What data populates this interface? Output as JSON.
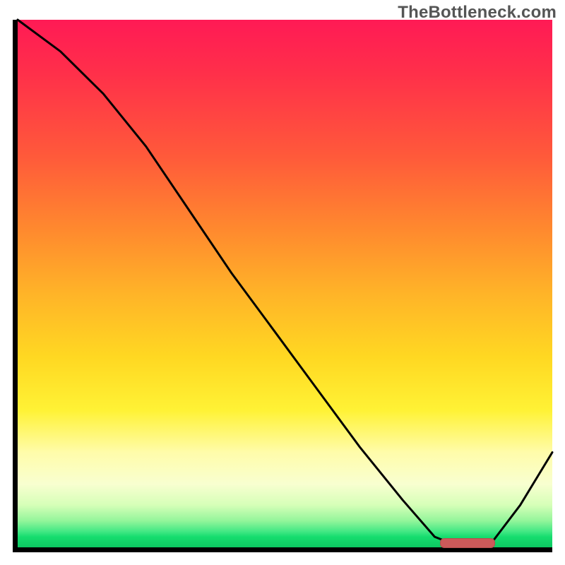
{
  "watermark": "TheBottleneck.com",
  "colors": {
    "axis": "#000000",
    "curve": "#000000",
    "marker": "#cc5a5a"
  },
  "chart_data": {
    "type": "line",
    "title": "",
    "xlabel": "",
    "ylabel": "",
    "xlim": [
      0,
      100
    ],
    "ylim": [
      0,
      100
    ],
    "x": [
      0,
      8,
      16,
      24,
      32,
      40,
      48,
      56,
      64,
      72,
      78,
      83,
      88,
      94,
      100
    ],
    "values": [
      100,
      94,
      86,
      76,
      64,
      52,
      41,
      30,
      19,
      9,
      2,
      0,
      0,
      8,
      18
    ],
    "annotations": [
      {
        "kind": "optimum-band",
        "x_start": 79,
        "x_end": 89,
        "y": 1
      }
    ],
    "gradient_stops": [
      {
        "pos": 0.0,
        "hex": "#ff1a55"
      },
      {
        "pos": 0.26,
        "hex": "#ff5a3a"
      },
      {
        "pos": 0.52,
        "hex": "#ffb428"
      },
      {
        "pos": 0.74,
        "hex": "#fff235"
      },
      {
        "pos": 0.92,
        "hex": "#d6ffb8"
      },
      {
        "pos": 1.0,
        "hex": "#0cc862"
      }
    ]
  }
}
